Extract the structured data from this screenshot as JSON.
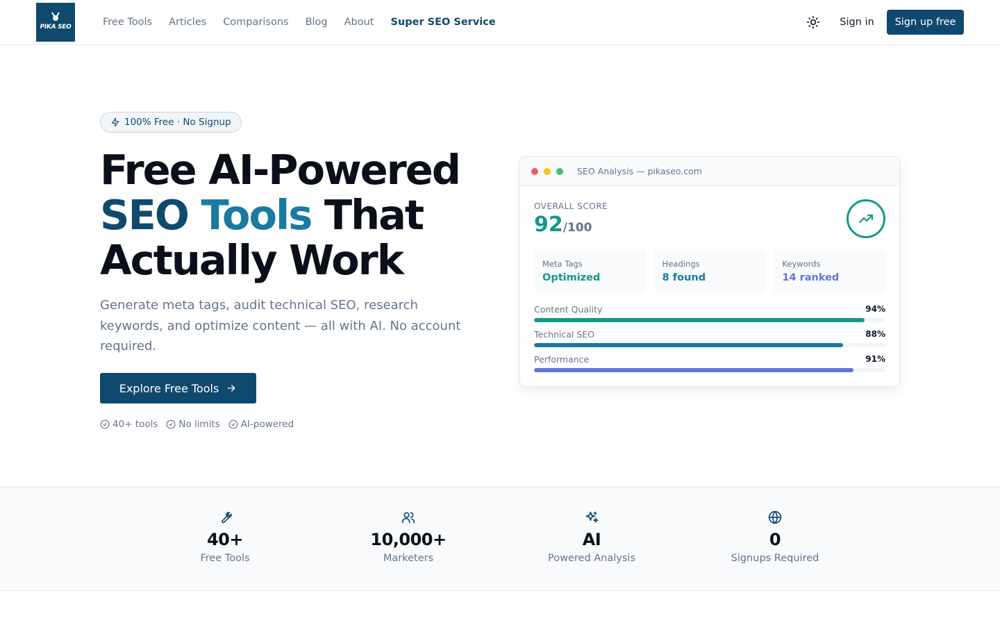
{
  "header": {
    "logo_text": "PIKA SEO",
    "nav": [
      "Free Tools",
      "Articles",
      "Comparisons",
      "Blog",
      "About"
    ],
    "featured_nav": "Super SEO Service",
    "signin_label": "Sign in",
    "signup_label": "Sign up free",
    "theme_icon": "sun-icon"
  },
  "hero": {
    "badge": "100% Free · No Signup",
    "title_line1": "Free AI-Powered",
    "title_grad_word1": "SEO",
    "title_grad_word2": "Tools",
    "title_after": "That",
    "title_line3": "Actually Work",
    "subtitle": "Generate meta tags, audit technical SEO, research keywords, and optimize content — all with AI. No account required.",
    "cta_label": "Explore Free Tools",
    "checks": [
      "40+ tools",
      "No limits",
      "AI-powered"
    ]
  },
  "card": {
    "title": "SEO Analysis — pikaseo.com",
    "score_label": "OVERALL SCORE",
    "score": "92",
    "score_of": "/100",
    "tiles": [
      {
        "label": "Meta Tags",
        "value": "Optimized",
        "color": "#129a88"
      },
      {
        "label": "Headings",
        "value": "8 found",
        "color": "#1a7aa0"
      },
      {
        "label": "Keywords",
        "value": "14 ranked",
        "color": "#6674d8"
      }
    ],
    "bars": [
      {
        "label": "Content Quality",
        "pct": "94%",
        "value": 94,
        "color": "#129a88"
      },
      {
        "label": "Technical SEO",
        "pct": "88%",
        "value": 88,
        "color": "#1a7aa0"
      },
      {
        "label": "Performance",
        "pct": "91%",
        "value": 91,
        "color": "#6674d8"
      }
    ]
  },
  "stats": [
    {
      "icon": "wrench-icon",
      "value": "40+",
      "label": "Free Tools"
    },
    {
      "icon": "users-icon",
      "value": "10,000+",
      "label": "Marketers"
    },
    {
      "icon": "sparkles-icon",
      "value": "AI",
      "label": "Powered Analysis"
    },
    {
      "icon": "globe-icon",
      "value": "0",
      "label": "Signups Required"
    }
  ],
  "colors": {
    "brand": "#0f4a6e",
    "accent_teal": "#129a88",
    "accent_blue": "#1a7aa0",
    "accent_indigo": "#6674d8",
    "dot_red": "#ef5e5e",
    "dot_yellow": "#f5c518",
    "dot_green": "#3cc36b"
  }
}
